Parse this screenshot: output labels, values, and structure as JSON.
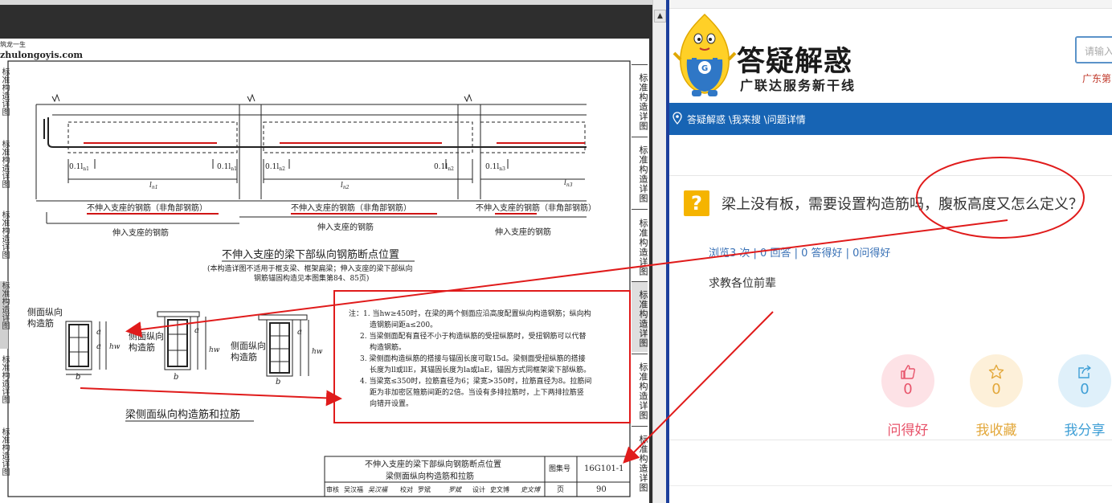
{
  "viewer": {
    "watermark_top": "筑龙一生",
    "watermark_site": "zhulongoyis.com",
    "scroll_up_glyph": "▲",
    "tab_label": "标准构造详图",
    "left_tab_label": "标准构造详图",
    "atlas": {
      "span_labels": [
        "l",
        "l",
        "l"
      ],
      "span_subs": [
        "n1",
        "n2",
        "n3"
      ],
      "tenth_label": "0.1l",
      "tenth_subs": [
        "n1",
        "n1",
        "n2",
        "n2",
        "n3"
      ],
      "not_support_label": "不伸入支座的钢筋（非角部钢筋）",
      "support_label": "伸入支座的钢筋",
      "section_title": "不伸入支座的梁下部纵向钢筋断点位置",
      "section_note_1": "(本构造详图不适用于框支梁、框架扁梁；伸入支座的梁下部纵向",
      "section_note_2": "钢筋锚固构造见本图集第84、85页)",
      "side_bar_label_1": "侧面纵向",
      "side_bar_label_2": "构造筋",
      "dim_a": "a",
      "dim_b": "b",
      "dim_hw": "hw",
      "side_section_title": "梁侧面纵向构造筋和拉筋",
      "notes": [
        "注：1. 当hw≥450时，在梁的两个侧面应沿高度配置纵向构造钢筋；纵向构",
        "造钢筋间距a≤200。",
        "2. 当梁侧面配有直径不小于构造纵筋的受扭纵筋时，受扭钢筋可以代替",
        "构造钢筋。",
        "3. 梁侧面构造纵筋的搭接与锚固长度可取15d。梁侧面受扭纵筋的搭接",
        "长度为ll或llE，其锚固长度为la或laE，锚固方式同框架梁下部纵筋。",
        "4. 当梁宽≤350时，拉筋直径为6；梁宽>350时，拉筋直径为8。拉筋间",
        "距为非加密区箍筋间距的2倍。当设有多排拉筋时，上下两排拉筋竖",
        "向错开设置。"
      ],
      "title_block": {
        "line1": "不伸入支座的梁下部纵向钢筋断点位置",
        "line2": "梁侧面纵向构造筋和拉筋",
        "atlas_no_label": "图集号",
        "atlas_no": "16G101-1",
        "page_label": "页",
        "page_no": "90",
        "review_label": "审核",
        "review_name": "吴汉福",
        "review_sig": "吴汉福",
        "check_label": "校对",
        "check_name": "罗斌",
        "check_sig": "罗斌",
        "design_label": "设计",
        "design_name": "史文博",
        "design_sig": "史文博"
      }
    }
  },
  "web": {
    "brand_title": "答疑解惑",
    "brand_subtitle": "广联达服务新干线",
    "search_placeholder": "请输入",
    "region_text": "广东第",
    "breadcrumb": "答疑解惑 \\我来搜 \\问题详情",
    "question_icon_glyph": "?",
    "question_title": "梁上没有板，需要设置构造筋吗，腹板高度又怎么定义？",
    "stats": "浏览3 次 | 0 回答 | 0 答得好 | 0问得好",
    "body_text": "求教各位前辈",
    "actions": [
      {
        "label": "问得好",
        "count": "0",
        "icon": "thumbs-up-icon",
        "color": "#e8546b",
        "bg": "#fde2e6"
      },
      {
        "label": "我收藏",
        "count": "0",
        "icon": "star-icon",
        "color": "#e3a83b",
        "bg": "#fdf0d9"
      },
      {
        "label": "我分享",
        "count": "0",
        "icon": "share-icon",
        "color": "#3f9fd6",
        "bg": "#dff0fa"
      }
    ],
    "colors": {
      "nav": "#1764b4",
      "accent_red": "#e01b1b",
      "question_icon": "#f5b400"
    }
  }
}
